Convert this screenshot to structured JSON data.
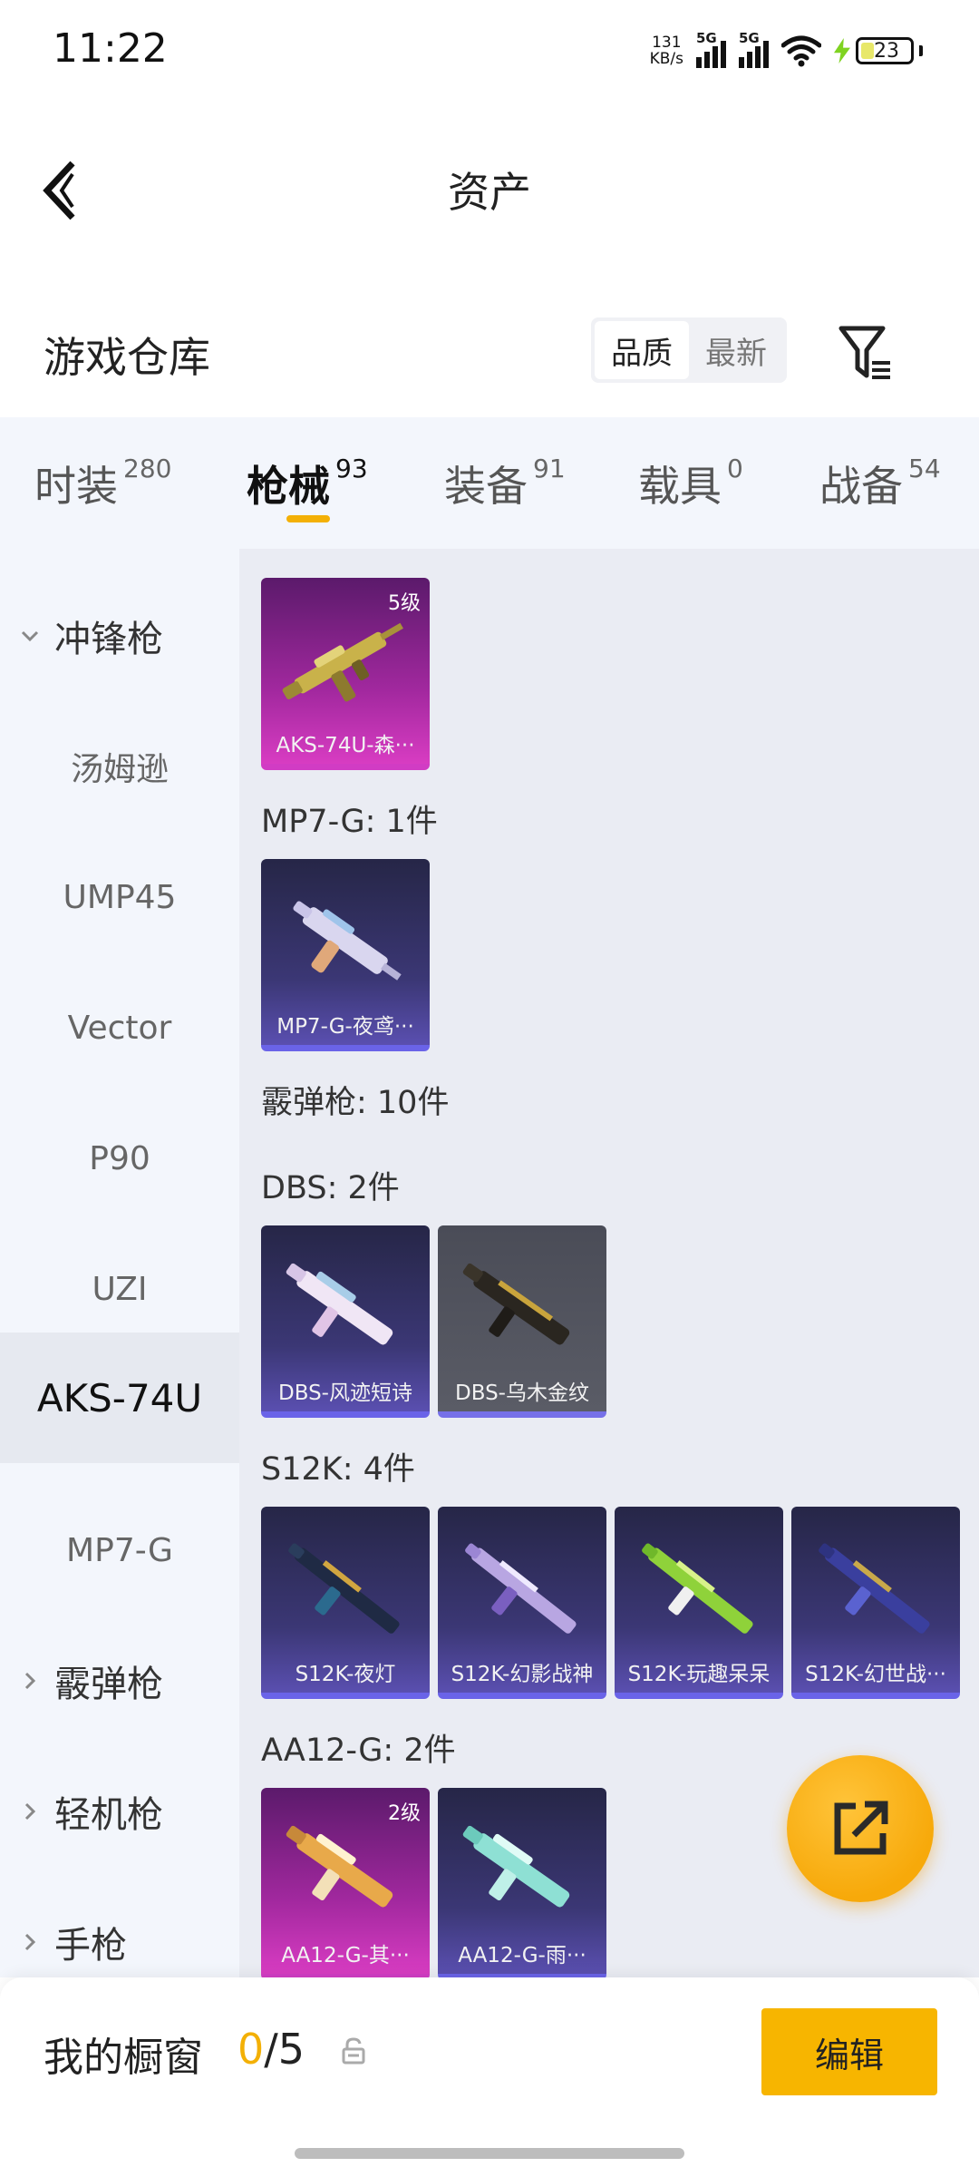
{
  "status": {
    "time": "11:22",
    "net_speed_value": "131",
    "net_speed_unit": "KB/s",
    "sim1": "5G",
    "sim2": "5G",
    "battery": "23"
  },
  "header": {
    "title": "资产"
  },
  "warehouse": {
    "title": "游戏仓库",
    "sort_quality": "品质",
    "sort_latest": "最新"
  },
  "tabs": [
    {
      "label": "时装",
      "count": "280"
    },
    {
      "label": "枪械",
      "count": "93"
    },
    {
      "label": "装备",
      "count": "91"
    },
    {
      "label": "载具",
      "count": "0"
    },
    {
      "label": "战备",
      "count": "54"
    }
  ],
  "sidebar": {
    "groups": [
      {
        "label": "冲锋枪",
        "expanded": true
      },
      {
        "label": "霰弹枪",
        "expanded": false
      },
      {
        "label": "轻机枪",
        "expanded": false
      },
      {
        "label": "手枪",
        "expanded": false
      }
    ],
    "items": [
      "汤姆逊",
      "UMP45",
      "Vector",
      "P90",
      "UZI",
      "AKS-74U",
      "MP7-G"
    ],
    "active": "AKS-74U"
  },
  "content": {
    "sections": [
      {
        "title": "MP7-G: 1件"
      },
      {
        "title": "霰弹枪: 10件"
      },
      {
        "title": "DBS: 2件"
      },
      {
        "title": "S12K: 4件"
      },
      {
        "title": "AA12-G: 2件"
      }
    ],
    "cards": [
      {
        "name": "AKS-74U-森···",
        "level": "5级",
        "rarity": "pink"
      },
      {
        "name": "MP7-G-夜鸢···",
        "level": "",
        "rarity": "blue"
      },
      {
        "name": "DBS-风迹短诗",
        "level": "",
        "rarity": "blue"
      },
      {
        "name": "DBS-乌木金纹",
        "level": "",
        "rarity": "gray"
      },
      {
        "name": "S12K-夜灯",
        "level": "",
        "rarity": "blue"
      },
      {
        "name": "S12K-幻影战神",
        "level": "",
        "rarity": "blue"
      },
      {
        "name": "S12K-玩趣呆呆",
        "level": "",
        "rarity": "blue"
      },
      {
        "name": "S12K-幻世战···",
        "level": "",
        "rarity": "blue"
      },
      {
        "name": "AA12-G-其···",
        "level": "2级",
        "rarity": "pink"
      },
      {
        "name": "AA12-G-雨···",
        "level": "",
        "rarity": "blue"
      }
    ]
  },
  "bottom": {
    "window_label": "我的橱窗",
    "window_used": "0",
    "window_total": "/5",
    "edit_label": "编辑"
  },
  "colors": {
    "accent": "#f7b500",
    "tab_indicator": "#f3b006",
    "sidebar_bg": "#f3f6fc",
    "content_bg": "#eaecf3"
  }
}
